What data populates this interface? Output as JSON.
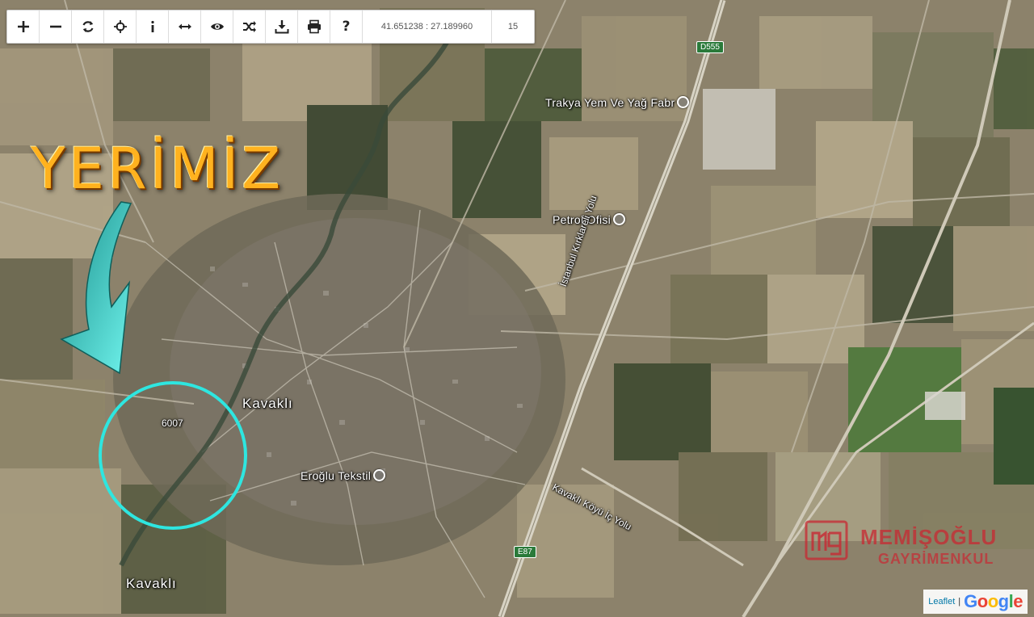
{
  "toolbar": {
    "buttons": [
      {
        "name": "zoom-in",
        "glyph": "+"
      },
      {
        "name": "zoom-out",
        "glyph": "−"
      },
      {
        "name": "refresh",
        "glyph": "refresh"
      },
      {
        "name": "locate",
        "glyph": "crosshair"
      },
      {
        "name": "info",
        "glyph": "i"
      },
      {
        "name": "measure",
        "glyph": "↔"
      },
      {
        "name": "view",
        "glyph": "eye"
      },
      {
        "name": "shuffle",
        "glyph": "shuffle"
      },
      {
        "name": "download",
        "glyph": "download"
      },
      {
        "name": "print",
        "glyph": "print"
      },
      {
        "name": "help",
        "glyph": "?"
      }
    ],
    "coordinates": "41.651238 : 27.189960",
    "zoom_level": "15"
  },
  "map": {
    "headline": "YERİMİZ",
    "parcel_number": "6007",
    "places": {
      "trakya": "Trakya Yem Ve Yağ Fabr",
      "petrol": "Petrol Ofisi",
      "eroglu": "Eroğlu Tekstil",
      "kavakli_center": "Kavaklı",
      "kavakli_south": "Kavaklı"
    },
    "roads": {
      "istanbul": "İstanbul Kırklareli Yolu",
      "kavakli_ic": "Kavaklı Köyü İç Yolu"
    },
    "shields": {
      "d555": "D555",
      "e87": "E87"
    },
    "colors": {
      "circle": "#2ee6e0",
      "arrow": "#35d6d0",
      "headline": "#ffb21f"
    }
  },
  "watermark": {
    "line1": "MEMİŞOĞLU",
    "line2": "GAYRİMENKUL",
    "logo_text": "mg"
  },
  "attribution": {
    "leaflet": "Leaflet",
    "separator": "|",
    "google": "Google"
  }
}
